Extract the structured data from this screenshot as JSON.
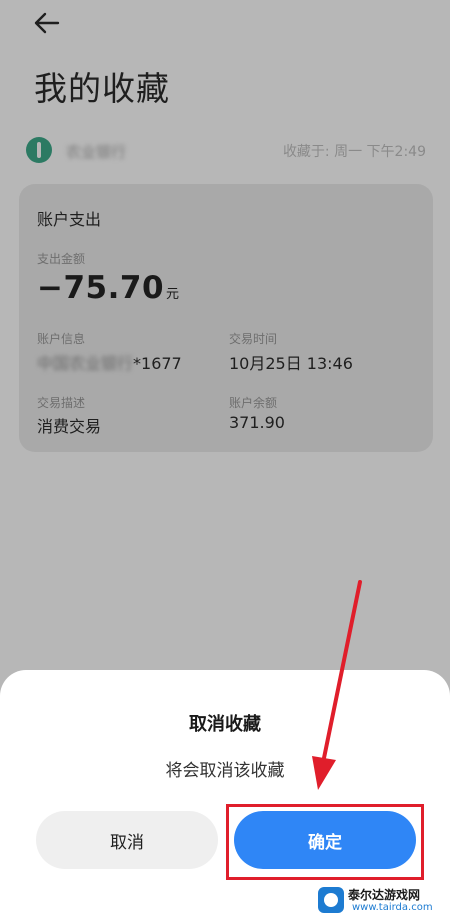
{
  "header": {
    "title": "我的收藏",
    "back_icon": "back-arrow-icon"
  },
  "source": {
    "bank_name": "农业银行",
    "collect_time": "收藏于: 周一 下午2:49"
  },
  "card": {
    "title": "账户支出",
    "amount_label": "支出金额",
    "amount": "−75.70",
    "amount_unit": "元",
    "account_label": "账户信息",
    "account_masked": "中国农业银行",
    "account_suffix": "*1677",
    "time_label": "交易时间",
    "time_value": "10月25日 13:46",
    "desc_label": "交易描述",
    "desc_value": "消费交易",
    "balance_label": "账户余额",
    "balance_value": "371.90"
  },
  "dialog": {
    "title": "取消收藏",
    "message": "将会取消该收藏",
    "cancel_label": "取消",
    "confirm_label": "确定"
  },
  "watermark": {
    "name": "泰尔达游戏网",
    "url": "www.tairda.com"
  },
  "colors": {
    "accent": "#2f86f6",
    "annotation": "#e01e2b"
  }
}
